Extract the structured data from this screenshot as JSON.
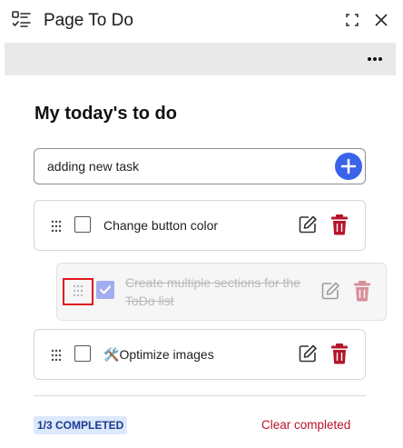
{
  "window": {
    "title": "Page To Do"
  },
  "icons": {
    "app": "checklist-icon",
    "expand": "expand-icon",
    "close": "close-icon",
    "more": "more-horizontal-icon",
    "add": "plus-icon",
    "drag": "drag-handle-icon",
    "edit": "edit-icon",
    "delete": "trash-icon",
    "tools": "hammer-wrench-icon"
  },
  "colors": {
    "accent": "#3a63ea",
    "danger": "#b5152b",
    "badge_bg": "#dce8fb",
    "badge_text": "#1a3b8f",
    "drag_highlight": "#e0171b"
  },
  "main": {
    "heading": "My today's to do",
    "new_task": {
      "value": "adding new task",
      "placeholder": ""
    }
  },
  "tasks": [
    {
      "label": "Change button color",
      "completed": false
    },
    {
      "label": "Create multiple sections for the ToDo list",
      "completed": true,
      "dragging": true
    },
    {
      "label": "Optimize images",
      "completed": false,
      "prefix_emoji": "🛠️"
    }
  ],
  "footer": {
    "completed_badge": "1/3 COMPLETED",
    "clear_label": "Clear completed"
  }
}
